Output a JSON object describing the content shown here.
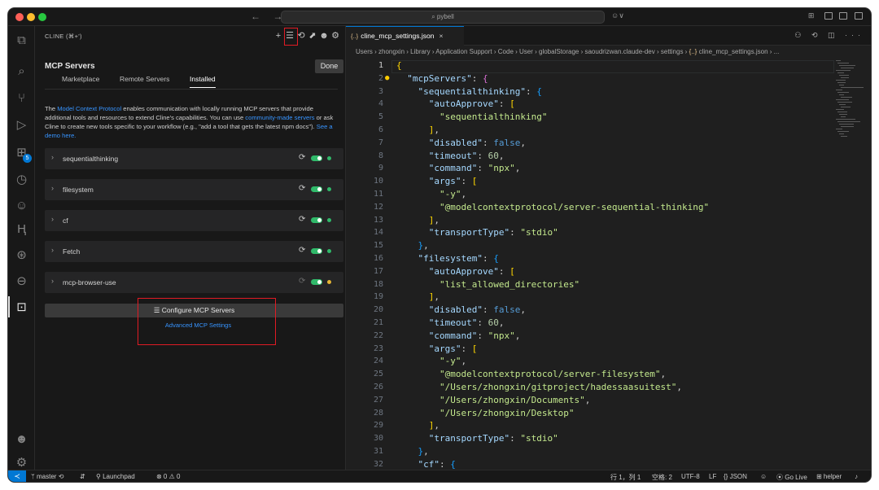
{
  "titlebar": {
    "nav_arrows": "← →",
    "search_text": "⌕ pybell",
    "copilot": "☺∨",
    "right_icons": "⊞"
  },
  "activity_bar": {
    "items": [
      {
        "name": "explorer-icon",
        "glyph": "⧉"
      },
      {
        "name": "search-icon",
        "glyph": "⌕"
      },
      {
        "name": "source-control-icon",
        "glyph": "⑂"
      },
      {
        "name": "run-debug-icon",
        "glyph": "▷"
      },
      {
        "name": "extensions-icon",
        "glyph": "⊞",
        "badge": "5"
      },
      {
        "name": "remote-icon",
        "glyph": "◷"
      },
      {
        "name": "copilot-icon",
        "glyph": "☺"
      },
      {
        "name": "hex-icon",
        "glyph": "Ⱨ"
      },
      {
        "name": "timeline-icon",
        "glyph": "⊛"
      },
      {
        "name": "gitlens-icon",
        "glyph": "⊖"
      },
      {
        "name": "cline-icon",
        "glyph": "⊡"
      }
    ],
    "bottom": [
      {
        "name": "account-icon",
        "glyph": "☻"
      },
      {
        "name": "settings-gear-icon",
        "glyph": "⚙"
      }
    ]
  },
  "sidebar": {
    "title": "CLINE (⌘+')",
    "actions": [
      "+",
      "☰",
      "⟲",
      "⬈",
      "☻",
      "⚙"
    ],
    "mcp_title": "MCP Servers",
    "done_label": "Done",
    "tabs": [
      "Marketplace",
      "Remote Servers",
      "Installed"
    ],
    "description": {
      "part1": "The ",
      "link1": "Model Context Protocol",
      "part2": " enables communication with locally running MCP servers that provide additional tools and resources to extend Cline's capabilities. You can use ",
      "link2": "community-made servers",
      "part3": " or ask Cline to create new tools specific to your workflow (e.g., \"add a tool that gets the latest npm docs\"). ",
      "link3": "See a demo here."
    },
    "servers": [
      {
        "name": "sequentialthinking",
        "status_color": "#30b96a",
        "dim": false
      },
      {
        "name": "filesystem",
        "status_color": "#30b96a",
        "dim": false
      },
      {
        "name": "cf",
        "status_color": "#30b96a",
        "dim": false
      },
      {
        "name": "Fetch",
        "status_color": "#30b96a",
        "dim": false
      },
      {
        "name": "mcp-browser-use",
        "status_color": "#e5b534",
        "dim": true
      }
    ],
    "configure_label": "Configure MCP Servers",
    "advanced_label": "Advanced MCP Settings"
  },
  "editor": {
    "tab_icon": "{..}",
    "tab_label": "cline_mcp_settings.json",
    "tab_close": "×",
    "tab_icons": "⚇ ⟲ ◫ ···",
    "breadcrumb": [
      "Users",
      "zhongxin",
      "Library",
      "Application Support",
      "Code",
      "User",
      "globalStorage",
      "saoudrizwan.claude-dev",
      "settings",
      "cline_mcp_settings.json",
      "..."
    ],
    "lines": [
      {
        "n": "1",
        "html": "<span class=\"p1\">{</span>"
      },
      {
        "n": "2",
        "html": "  <span class=\"k\">\"mcpServers\"</span>: <span class=\"p2\">{</span>"
      },
      {
        "n": "3",
        "html": "    <span class=\"k\">\"sequentialthinking\"</span>: <span class=\"p3\">{</span>"
      },
      {
        "n": "4",
        "html": "      <span class=\"k\">\"autoApprove\"</span>: <span class=\"p1\">[</span>"
      },
      {
        "n": "5",
        "html": "        <span class=\"str\">\"sequentialthinking\"</span>"
      },
      {
        "n": "6",
        "html": "      <span class=\"p1\">]</span>,"
      },
      {
        "n": "7",
        "html": "      <span class=\"k\">\"disabled\"</span>: <span class=\"b\">false</span>,"
      },
      {
        "n": "8",
        "html": "      <span class=\"k\">\"timeout\"</span>: <span class=\"num\">60</span>,"
      },
      {
        "n": "9",
        "html": "      <span class=\"k\">\"command\"</span>: <span class=\"str\">\"npx\"</span>,"
      },
      {
        "n": "10",
        "html": "      <span class=\"k\">\"args\"</span>: <span class=\"p1\">[</span>"
      },
      {
        "n": "11",
        "html": "        <span class=\"str\">\"-y\"</span>,"
      },
      {
        "n": "12",
        "html": "        <span class=\"str\">\"@modelcontextprotocol/server-sequential-thinking\"</span>"
      },
      {
        "n": "13",
        "html": "      <span class=\"p1\">]</span>,"
      },
      {
        "n": "14",
        "html": "      <span class=\"k\">\"transportType\"</span>: <span class=\"str\">\"stdio\"</span>"
      },
      {
        "n": "15",
        "html": "    <span class=\"p3\">}</span>,"
      },
      {
        "n": "16",
        "html": "    <span class=\"k\">\"filesystem\"</span>: <span class=\"p3\">{</span>"
      },
      {
        "n": "17",
        "html": "      <span class=\"k\">\"autoApprove\"</span>: <span class=\"p1\">[</span>"
      },
      {
        "n": "18",
        "html": "        <span class=\"str\">\"list_allowed_directories\"</span>"
      },
      {
        "n": "19",
        "html": "      <span class=\"p1\">]</span>,"
      },
      {
        "n": "20",
        "html": "      <span class=\"k\">\"disabled\"</span>: <span class=\"b\">false</span>,"
      },
      {
        "n": "21",
        "html": "      <span class=\"k\">\"timeout\"</span>: <span class=\"num\">60</span>,"
      },
      {
        "n": "22",
        "html": "      <span class=\"k\">\"command\"</span>: <span class=\"str\">\"npx\"</span>,"
      },
      {
        "n": "23",
        "html": "      <span class=\"k\">\"args\"</span>: <span class=\"p1\">[</span>"
      },
      {
        "n": "24",
        "html": "        <span class=\"str\">\"-y\"</span>,"
      },
      {
        "n": "25",
        "html": "        <span class=\"str\">\"@modelcontextprotocol/server-filesystem\"</span>,"
      },
      {
        "n": "26",
        "html": "        <span class=\"str\">\"/Users/zhongxin/gitproject/hadessaasuitest\"</span>,"
      },
      {
        "n": "27",
        "html": "        <span class=\"str\">\"/Users/zhongxin/Documents\"</span>,"
      },
      {
        "n": "28",
        "html": "        <span class=\"str\">\"/Users/zhongxin/Desktop\"</span>"
      },
      {
        "n": "29",
        "html": "      <span class=\"p1\">]</span>,"
      },
      {
        "n": "30",
        "html": "      <span class=\"k\">\"transportType\"</span>: <span class=\"str\">\"stdio\"</span>"
      },
      {
        "n": "31",
        "html": "    <span class=\"p3\">}</span>,"
      },
      {
        "n": "32",
        "html": "    <span class=\"k\">\"cf\"</span>: <span class=\"p3\">{</span>"
      }
    ]
  },
  "statusbar": {
    "remote": "≺",
    "branch": "ᛘ master ⟲",
    "sync": "⇵",
    "launchpad": "⚲ Launchpad",
    "problems": "⊗ 0 ⚠ 0",
    "cursor": "行 1，列 1",
    "spaces": "空格: 2",
    "encoding": "UTF-8",
    "eol": "LF",
    "language": "{} JSON",
    "copilot": "☺",
    "golive": "⦿ Go Live",
    "helper": "⊞ helper",
    "bell": "♪"
  }
}
